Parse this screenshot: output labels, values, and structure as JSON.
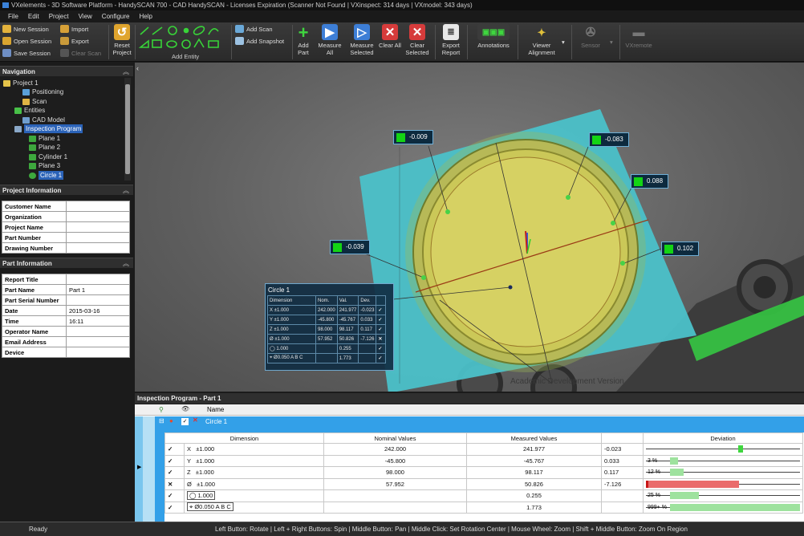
{
  "titlebar": {
    "text": "VXelements - 3D Software Platform - HandySCAN 700 - CAD HandySCAN - Licenses Expiration (Scanner Not Found | VXinspect: 314 days | VXmodel: 343 days)"
  },
  "menu": [
    "File",
    "Edit",
    "Project",
    "View",
    "Configure",
    "Help"
  ],
  "ribbon": {
    "new_session": "New Session",
    "open_session": "Open Session",
    "save_session": "Save Session",
    "import": "Import",
    "export": "Export",
    "clear_scan": "Clear Scan",
    "reset_project": "Reset Project",
    "add_entity": "Add Entity",
    "add_scan": "Add Scan",
    "add_snapshot": "Add Snapshot",
    "add_part": "Add Part",
    "measure_all": "Measure All",
    "measure_selected": "Measure Selected",
    "clear_all": "Clear All",
    "clear_selected": "Clear Selected",
    "export_report": "Export Report",
    "annotations": "Annotations",
    "viewer_alignment": "Viewer Alignment",
    "sensor": "Sensor",
    "vxremote": "VXremote"
  },
  "navigation": {
    "title": "Navigation",
    "items": [
      "Project 1",
      "Positioning",
      "Scan",
      "Entities",
      "CAD Model",
      "Inspection Program",
      "Plane 1",
      "Plane 2",
      "Cylinder 1",
      "Plane 3",
      "Circle 1"
    ]
  },
  "project_info": {
    "title": "Project Information",
    "rows": [
      {
        "k": "Customer Name",
        "v": ""
      },
      {
        "k": "Organization",
        "v": ""
      },
      {
        "k": "Project Name",
        "v": ""
      },
      {
        "k": "Part Number",
        "v": ""
      },
      {
        "k": "Drawing Number",
        "v": ""
      }
    ]
  },
  "part_info": {
    "title": "Part Information",
    "rows": [
      {
        "k": "Report Title",
        "v": ""
      },
      {
        "k": "Part Name",
        "v": "Part 1"
      },
      {
        "k": "Part Serial Number",
        "v": ""
      },
      {
        "k": "Date",
        "v": "2015-03-16"
      },
      {
        "k": "Time",
        "v": "16:11"
      },
      {
        "k": "Operator Name",
        "v": ""
      },
      {
        "k": "Email Address",
        "v": ""
      },
      {
        "k": "Device",
        "v": ""
      }
    ]
  },
  "viewport": {
    "callouts": [
      "-0.009",
      "-0.083",
      "0.088",
      "-0.039",
      "0.102"
    ],
    "watermark": "Academic Development Version",
    "circle_panel": {
      "title": "Circle 1",
      "headers": [
        "Dimension",
        "Nom.",
        "Val.",
        "Dev."
      ],
      "rows": [
        {
          "label": "X  ±1.000",
          "nom": "242.000",
          "val": "241.977",
          "dev": "-0.023",
          "ok": true
        },
        {
          "label": "Y  ±1.000",
          "nom": "-45.800",
          "val": "-45.767",
          "dev": "0.033",
          "ok": true
        },
        {
          "label": "Z  ±1.000",
          "nom": "98.000",
          "val": "98.117",
          "dev": "0.117",
          "ok": true
        },
        {
          "label": "Ø  ±1.000",
          "nom": "57.952",
          "val": "50.826",
          "dev": "-7.126",
          "ok": false
        },
        {
          "label": "◯ 1.000",
          "nom": "",
          "val": "0.255",
          "dev": "",
          "ok": true
        },
        {
          "label": "⌖ Ø0.050 A B C",
          "nom": "",
          "val": "1.773",
          "dev": "",
          "ok": true
        }
      ]
    }
  },
  "inspection": {
    "title": "Inspection Program - Part 1",
    "name_header": "Name",
    "selected_item": "Circle 1",
    "headers": [
      "Dimension",
      "Nominal Values",
      "Measured Values",
      "",
      "Deviation"
    ],
    "rows": [
      {
        "sym": "X",
        "tol": "±1.000",
        "nominal": "242.000",
        "measured": "241.977",
        "dev": "-0.023",
        "pct": "",
        "fill": 0.02,
        "ok": true
      },
      {
        "sym": "Y",
        "tol": "±1.000",
        "nominal": "-45.800",
        "measured": "-45.767",
        "dev": "0.033",
        "pct": "3 %",
        "fill": 0.03,
        "ok": true
      },
      {
        "sym": "Z",
        "tol": "±1.000",
        "nominal": "98.000",
        "measured": "98.117",
        "dev": "0.117",
        "pct": "12 %",
        "fill": 0.12,
        "ok": true
      },
      {
        "sym": "Ø",
        "tol": "±1.000",
        "nominal": "57.952",
        "measured": "50.826",
        "dev": "-7.126",
        "pct": "",
        "fill": 1.0,
        "ok": false
      },
      {
        "sym": "◯",
        "tol": "1.000",
        "nominal": "",
        "measured": "0.255",
        "dev": "",
        "pct": "25 %",
        "fill": 0.25,
        "ok": true
      },
      {
        "sym": "⌖",
        "tol": "Ø0.050 A B C",
        "nominal": "",
        "measured": "1.773",
        "dev": "",
        "pct": "999+ %",
        "fill": 1.0,
        "ok": true
      }
    ]
  },
  "status": {
    "ready": "Ready",
    "hint": "Left Button: Rotate  |  Left + Right Buttons: Spin  |  Middle Button: Pan  |  Middle Click: Set Rotation Center  |  Mouse Wheel: Zoom  |  Shift + Middle Button: Zoom On Region"
  },
  "colors": {
    "accent": "#2b63b8",
    "ok": "#14d414",
    "fail": "#e03030",
    "part": "#4fc6cf",
    "circle": "#c9c84e"
  }
}
